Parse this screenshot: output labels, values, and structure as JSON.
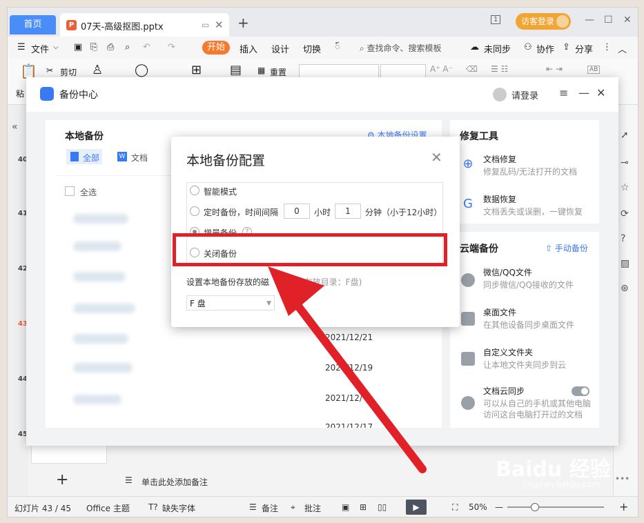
{
  "tabs": {
    "home": "首页",
    "doc_title": "07天-高级抠图.pptx",
    "doc_icon": "P"
  },
  "titlebar": {
    "login": "访客登录",
    "layout_badge": "1"
  },
  "menu": {
    "file": "文件",
    "active": "开始",
    "items": [
      "插入",
      "设计",
      "切换",
      "៍"
    ],
    "search": "查找命令、搜索模板",
    "right": [
      "未同步",
      "协作",
      "分享"
    ]
  },
  "ribbon": {
    "paste": "粘",
    "cut": "剪切",
    "reset": "重置",
    "ab": "AB"
  },
  "slides": {
    "numbers": [
      "40",
      "41",
      "42",
      "43",
      "44",
      "45"
    ],
    "active": "43"
  },
  "backup_center": {
    "title": "备份中心",
    "login": "请登录",
    "local": {
      "title": "本地备份",
      "settings_link": "本地备份设置",
      "filters": [
        "全部",
        "文档"
      ],
      "select_all": "全选",
      "dates": [
        "2021/12/21",
        "2021/12/19",
        "2021/12/",
        "2021/12/17"
      ]
    },
    "repair": {
      "title": "修复工具",
      "items": [
        {
          "name": "文档修复",
          "desc": "修复乱码/无法打开的文档"
        },
        {
          "name": "数据恢复",
          "desc": "文档丢失或误删，一键恢复"
        }
      ]
    },
    "cloud": {
      "title": "云端备份",
      "manual": "手动备份",
      "items": [
        {
          "name": "微信/QQ文件",
          "desc": "同步微信/QQ接收的文件"
        },
        {
          "name": "桌面文件",
          "desc": "在其他设备同步桌面文件"
        },
        {
          "name": "自定义文件夹",
          "desc": "让本地文件夹同步到云"
        },
        {
          "name": "文档云同步",
          "desc": "可以从自己的手机或其他电脑",
          "desc2": "访问这台电脑打开过的文档"
        }
      ]
    }
  },
  "config_dialog": {
    "title": "本地备份配置",
    "options": {
      "smart": "智能模式",
      "timed_prefix": "定时备份，时间间隔",
      "hours": "0",
      "hours_unit": "小时",
      "minutes": "1",
      "minutes_unit": "分钟（小于12小时）",
      "incremental": "增量备份",
      "off": "关闭备份"
    },
    "disk_label": "设置本地备份存放的磁",
    "current_dir": "(当前存放目录：F盘)",
    "disk_value": "F 盘"
  },
  "notes": {
    "placeholder": "单击此处添加备注"
  },
  "status": {
    "slide": "幻灯片 43 / 45",
    "theme": "Office 主题",
    "missing_font": "缺失字体",
    "notes": "备注",
    "comment": "批注",
    "zoom": "50%"
  },
  "watermark": {
    "main": "Baidu 经验",
    "sub": "jingyan.baidu.com"
  },
  "colors": {
    "accent": "#4a8df8",
    "active_tab": "#f47a2f",
    "login": "#f2a533",
    "highlight": "#e02128"
  }
}
